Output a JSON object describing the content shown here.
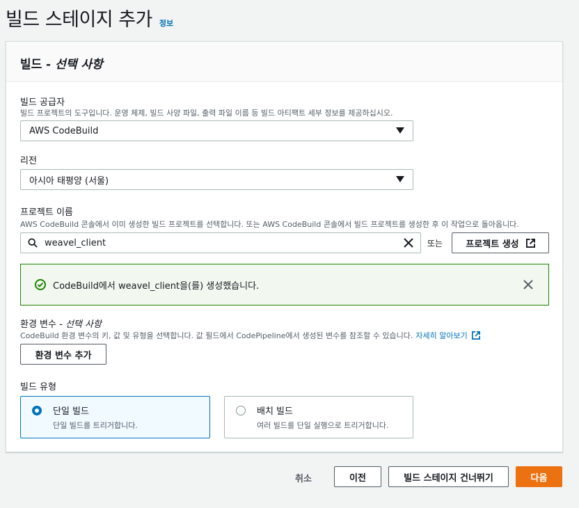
{
  "page": {
    "title": "빌드 스테이지 추가",
    "info_link": "정보"
  },
  "panel": {
    "title": "빌드",
    "title_optional": "- 선택 사항"
  },
  "provider": {
    "label": "빌드 공급자",
    "description": "빌드 프로젝트의 도구입니다. 운영 체제, 빌드 사양 파일, 출력 파일 이름 등 빌드 아티팩트 세부 정보를 제공하십시오.",
    "value": "AWS CodeBuild"
  },
  "region": {
    "label": "리전",
    "value": "아시아 태평양 (서울)"
  },
  "project": {
    "label": "프로젝트 이름",
    "description": "AWS CodeBuild 콘솔에서 이미 생성한 빌드 프로젝트를 선택합니다. 또는 AWS CodeBuild 콘솔에서 빌드 프로젝트를 생성한 후 이 작업으로 돌아옵니다.",
    "search_value": "weavel_client",
    "or_text": "또는",
    "create_button": "프로젝트 생성"
  },
  "flash": {
    "message": "CodeBuild에서 weavel_client을(를) 생성했습니다."
  },
  "env": {
    "label": "환경 변수",
    "label_optional": "- 선택 사항",
    "description": "CodeBuild 환경 변수의 키, 값 및 유형을 선택합니다. 값 필드에서 CodePipeline에서 생성된 변수를 참조할 수 있습니다.",
    "learn_more": "자세히 알아보기",
    "add_button": "환경 변수 추가"
  },
  "build_type": {
    "label": "빌드 유형",
    "options": [
      {
        "title": "단일 빌드",
        "description": "단일 빌드를 트리거합니다.",
        "selected": true
      },
      {
        "title": "배치 빌드",
        "description": "여러 빌드를 단일 실행으로 트리거합니다.",
        "selected": false
      }
    ]
  },
  "footer": {
    "cancel": "취소",
    "previous": "이전",
    "skip": "빌드 스테이지 건너뛰기",
    "next": "다음"
  },
  "colors": {
    "link": "#0073bb",
    "primary": "#ec7211",
    "success": "#1d8102"
  }
}
